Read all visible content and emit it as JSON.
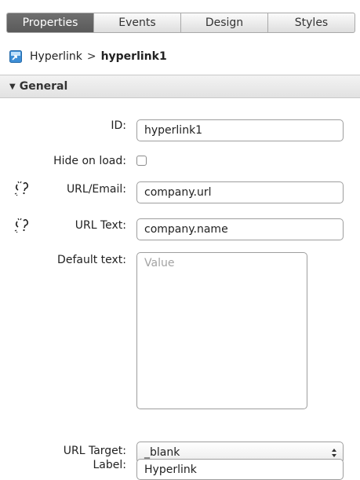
{
  "tabs": [
    {
      "label": "Properties"
    },
    {
      "label": "Events"
    },
    {
      "label": "Design"
    },
    {
      "label": "Styles"
    }
  ],
  "breadcrumb": {
    "parent": "Hyperlink",
    "separator": ">",
    "current": "hyperlink1"
  },
  "section": {
    "title": "General"
  },
  "form": {
    "id_label": "ID:",
    "id_value": "hyperlink1",
    "hide_label": "Hide on load:",
    "url_label": "URL/Email:",
    "url_value": "company.url",
    "url_text_label": "URL Text:",
    "url_text_value": "company.name",
    "default_text_label": "Default text:",
    "default_text_placeholder": "Value",
    "url_target_label": "URL Target:",
    "url_target_value": "_blank",
    "label_label": "Label:",
    "label_value": "Hyperlink"
  },
  "icons": [
    "hyperlink-widget-icon",
    "broken-link-icon",
    "select-arrows-icon",
    "disclosure-triangle-icon"
  ]
}
